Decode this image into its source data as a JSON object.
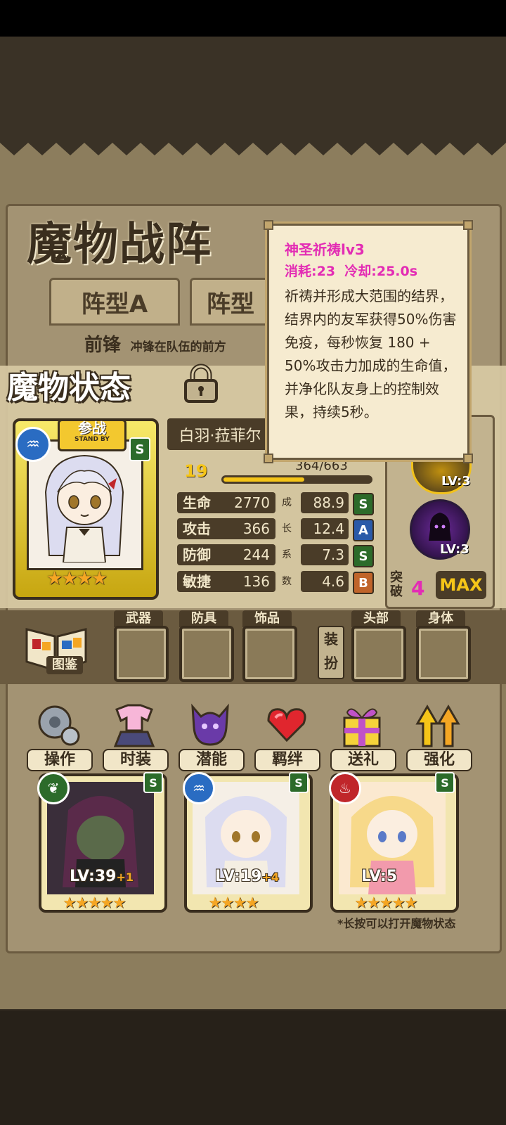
{
  "title": "魔物战阵",
  "tabs": [
    "阵型A",
    "阵型"
  ],
  "formation": {
    "label": "前锋",
    "desc": "冲锋在队伍的前方"
  },
  "status_panel": {
    "title": "魔物状态",
    "name": "白羽·菈菲尔",
    "level": "19",
    "exp": "364/663",
    "exp_fraction": 0.55,
    "standby": {
      "cn": "参战",
      "en": "STAND BY"
    },
    "grade": "S",
    "stars": "★★★★",
    "stats": [
      {
        "label": "生命",
        "value": "2770",
        "growth_char": "成",
        "growth": "88.9",
        "grade": "S",
        "grade_color": "#2c6b2a"
      },
      {
        "label": "攻击",
        "value": "366",
        "growth_char": "长",
        "growth": "12.4",
        "grade": "A",
        "grade_color": "#2a5aa8"
      },
      {
        "label": "防御",
        "value": "244",
        "growth_char": "系",
        "growth": "7.3",
        "grade": "S",
        "grade_color": "#2c6b2a"
      },
      {
        "label": "敏捷",
        "value": "136",
        "growth_char": "数",
        "growth": "4.6",
        "grade": "B",
        "grade_color": "#c0642a"
      }
    ],
    "skills": [
      {
        "lv": "LV:3"
      },
      {
        "lv": "LV:3"
      }
    ],
    "break": {
      "label_1": "突",
      "label_2": "破",
      "value": "4"
    },
    "max_label": "MAX"
  },
  "equipment": {
    "book_label": "图鉴",
    "slots": [
      {
        "label": "武器"
      },
      {
        "label": "防具"
      },
      {
        "label": "饰品"
      },
      {
        "label": "头部"
      },
      {
        "label": "身体"
      }
    ],
    "dress_tag": "装扮"
  },
  "actions": [
    {
      "label": "操作",
      "icon": "gear-icon"
    },
    {
      "label": "时装",
      "icon": "outfit-icon"
    },
    {
      "label": "潜能",
      "icon": "potential-icon"
    },
    {
      "label": "羁绊",
      "icon": "heart-icon"
    },
    {
      "label": "送礼",
      "icon": "gift-icon"
    },
    {
      "label": "强化",
      "icon": "arrows-up-icon"
    }
  ],
  "cards": [
    {
      "lv": "LV:39",
      "plus": "+1",
      "grade": "S",
      "element": "leaf",
      "element_color": "#2c6b2a",
      "stars": "★★★★★"
    },
    {
      "lv": "LV:19",
      "plus": "+4",
      "grade": "S",
      "element": "water",
      "element_color": "#2a6cc2",
      "stars": "★★★★"
    },
    {
      "lv": "LV:5",
      "plus": "",
      "grade": "S",
      "element": "fire",
      "element_color": "#c0262a",
      "stars": "★★★★★"
    }
  ],
  "hint": "*长按可以打开魔物状态",
  "tooltip": {
    "name": "神圣祈祷lv3",
    "cost": "消耗:23  冷却:25.0s",
    "desc": "祈祷并形成大范围的结界，结界内的友军获得50%伤害免疫，每秒恢复 180 + 50%攻击力加成的生命值，并净化队友身上的控制效果，持续5秒。"
  }
}
